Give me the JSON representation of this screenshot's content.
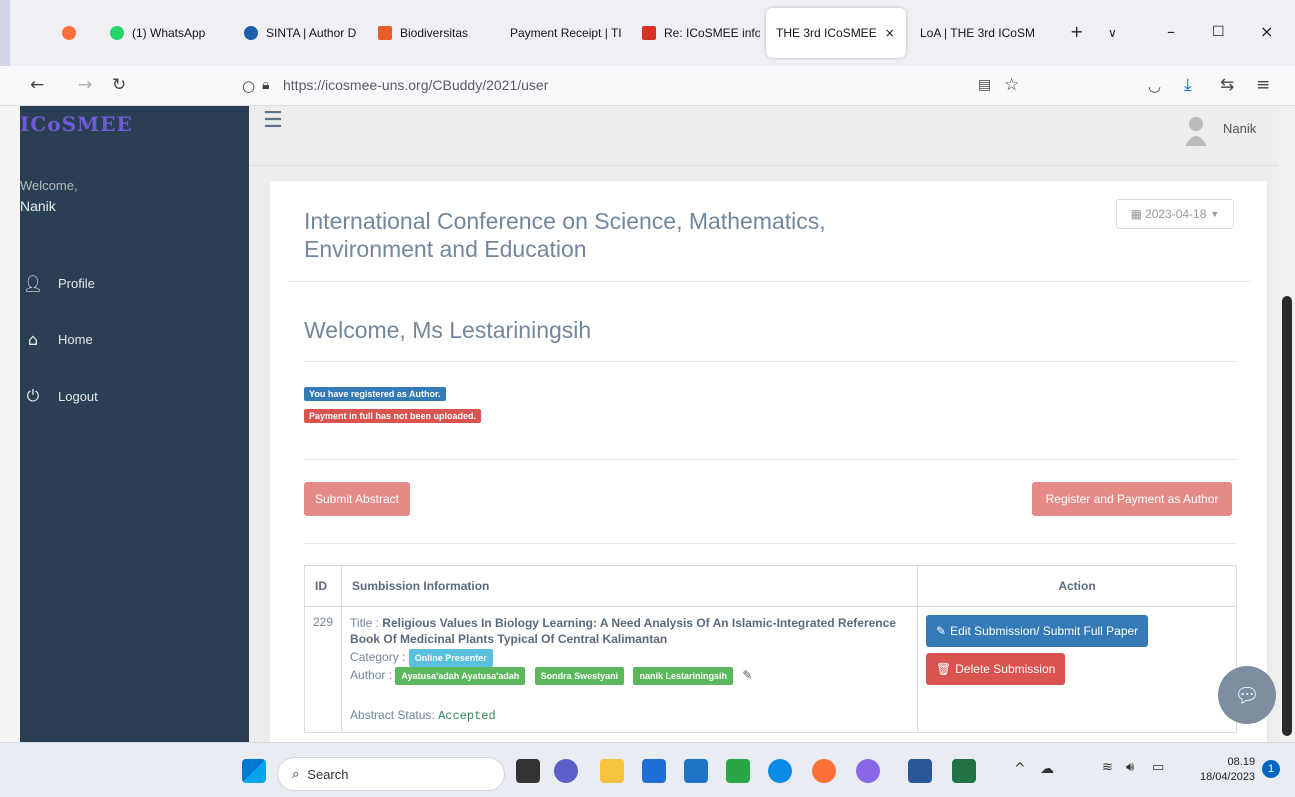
{
  "browser": {
    "tabs": [
      {
        "label": "",
        "color": "#ff7139"
      },
      {
        "label": "(1) WhatsApp",
        "color": "#25d366"
      },
      {
        "label": "SINTA | Author D",
        "color": "#1f5ea8"
      },
      {
        "label": "Biodiversitas",
        "color": "#e85d2a"
      },
      {
        "label": "Payment Receipt | TI",
        "color": "#888888"
      },
      {
        "label": "Re: ICoSMEE info",
        "color": "#d93025"
      },
      {
        "label": "THE 3rd ICoSMEE",
        "color": "#888888"
      },
      {
        "label": "LoA | THE 3rd ICoSM",
        "color": "#888888"
      }
    ],
    "url": "https://icosmee-uns.org/CBuddy/2021/user"
  },
  "sidebar": {
    "logo": "ICoSMEE",
    "welcome": "Welcome,",
    "user": "Nanik",
    "menu": [
      {
        "label": "Profile",
        "icon": "user-icon"
      },
      {
        "label": "Home",
        "icon": "home-icon"
      },
      {
        "label": "Logout",
        "icon": "power-icon"
      }
    ]
  },
  "topnav": {
    "user": "Nanik"
  },
  "main": {
    "conf_title": "International Conference on Science, Mathematics, Environment and Education",
    "date": "2023-04-18",
    "welcome_title": "Welcome, Ms Lestariningsih",
    "status_registered": "You have registered as Author.",
    "status_payment": "Payment in full has not been uploaded.",
    "submit_abstract": "Submit Abstract",
    "register_payment": "Register and Payment as Author",
    "table": {
      "headers": [
        "ID",
        "Sumbission Information",
        "Action"
      ],
      "row": {
        "id": "229",
        "title_label": "Title :",
        "title": "Religious Values In Biology Learning: A Need Analysis Of An Islamic-Integrated Reference Book Of Medicinal Plants Typical Of Central Kalimantan",
        "category_label": "Category :",
        "category": "Online Presenter",
        "author_label": "Author :",
        "authors": [
          "Ayatusa'adah Ayatusa'adah",
          "Sondra Swestyani",
          "nanik Lestariningsih"
        ],
        "abstract_status_label": "Abstract Status:",
        "abstract_status": "Accepted",
        "edit_button": "Edit Submission/ Submit Full Paper",
        "delete_button": "Delete Submission"
      }
    }
  },
  "taskbar": {
    "search": "Search",
    "time": "08.19",
    "date": "18/04/2023",
    "badge": "1"
  },
  "colors": {
    "sidebar": "#2a3f54",
    "primary": "#337ab7",
    "danger": "#d9534f",
    "danger_light": "#e68a87",
    "success": "#5cb85c",
    "info": "#5bc0de"
  }
}
